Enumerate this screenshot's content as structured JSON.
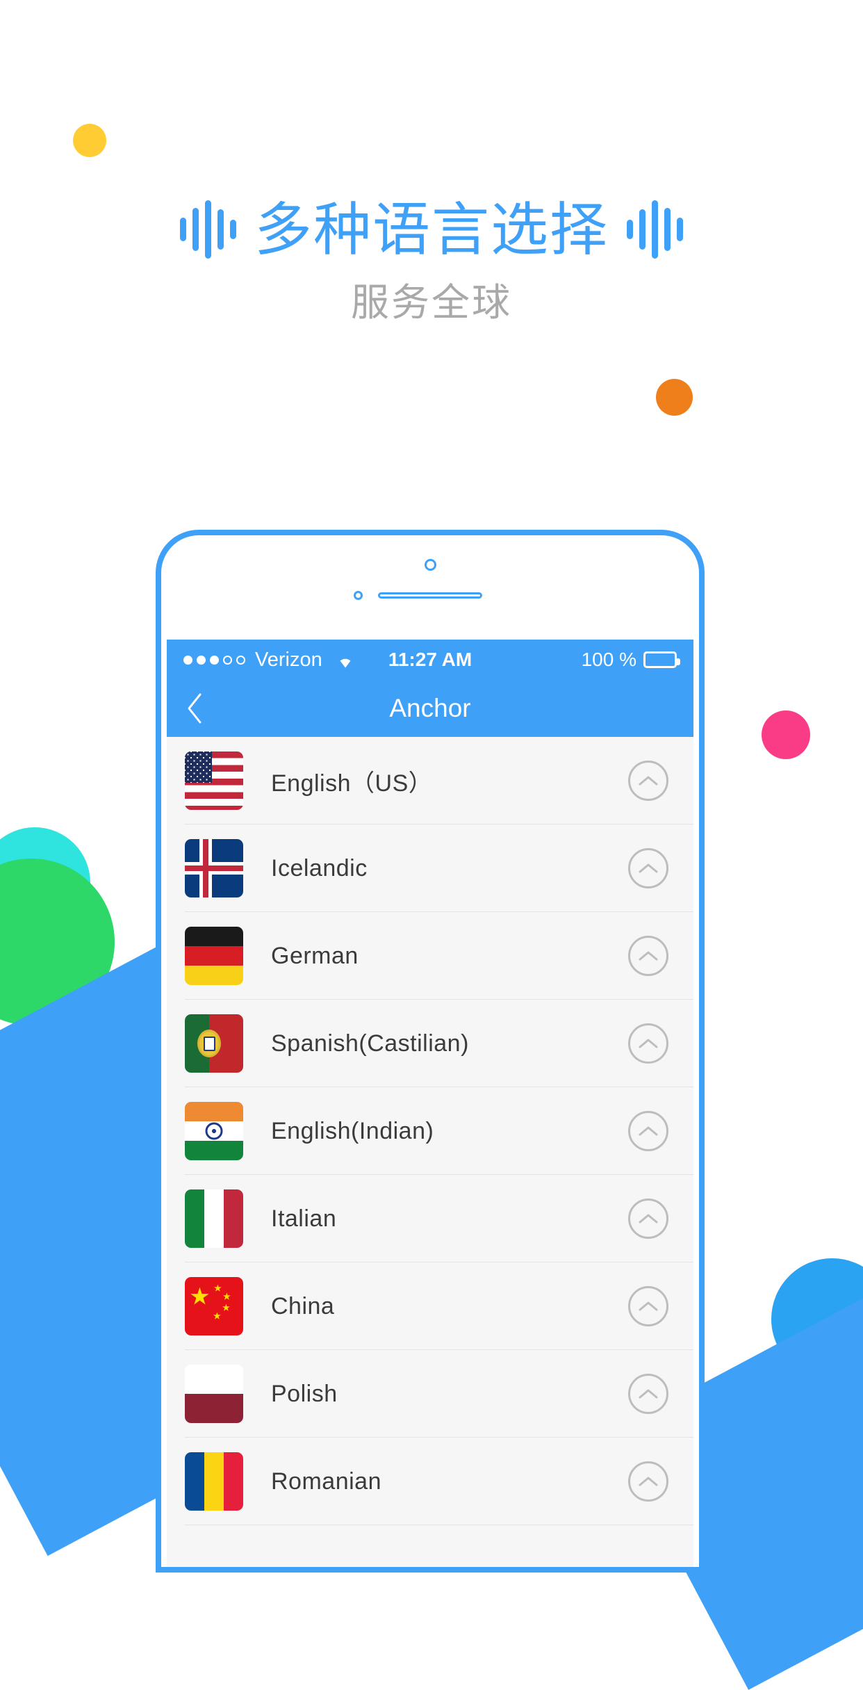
{
  "hero": {
    "headline": "多种语言选择",
    "subhead": "服务全球",
    "accent_color": "#3FA0F7",
    "subhead_color": "#A9A9A9"
  },
  "decorations": [
    {
      "name": "dot-yellow",
      "color": "#FFCC33"
    },
    {
      "name": "dot-orange",
      "color": "#EF7F1A"
    },
    {
      "name": "dot-pink",
      "color": "#FA3C87"
    },
    {
      "name": "dot-cyan",
      "color": "#2FE3DF"
    },
    {
      "name": "dot-green",
      "color": "#2DD868"
    },
    {
      "name": "dot-blue",
      "color": "#29A3F2"
    }
  ],
  "phone": {
    "status_bar": {
      "signal_bars_filled": 3,
      "signal_bars_total": 5,
      "carrier": "Verizon",
      "wifi": "wifi-icon",
      "time": "11:27 AM",
      "battery_percent": "100 %",
      "battery_level": 100
    },
    "nav_bar": {
      "back": "‹",
      "title": "Anchor"
    },
    "list": {
      "rows": [
        {
          "name": "English（US）",
          "flag": "us",
          "action": "chevron-up-icon"
        },
        {
          "name": "Icelandic",
          "flag": "is",
          "action": "chevron-up-icon"
        },
        {
          "name": "German",
          "flag": "de",
          "action": "chevron-up-icon"
        },
        {
          "name": "Spanish(Castilian)",
          "flag": "pt",
          "action": "chevron-up-icon"
        },
        {
          "name": "English(Indian)",
          "flag": "in",
          "action": "chevron-up-icon"
        },
        {
          "name": "Italian",
          "flag": "it",
          "action": "chevron-up-icon"
        },
        {
          "name": "China",
          "flag": "cn",
          "action": "chevron-up-icon"
        },
        {
          "name": "Polish",
          "flag": "pl",
          "action": "chevron-up-icon"
        },
        {
          "name": "Romanian",
          "flag": "ro",
          "action": "chevron-up-icon"
        }
      ]
    }
  }
}
